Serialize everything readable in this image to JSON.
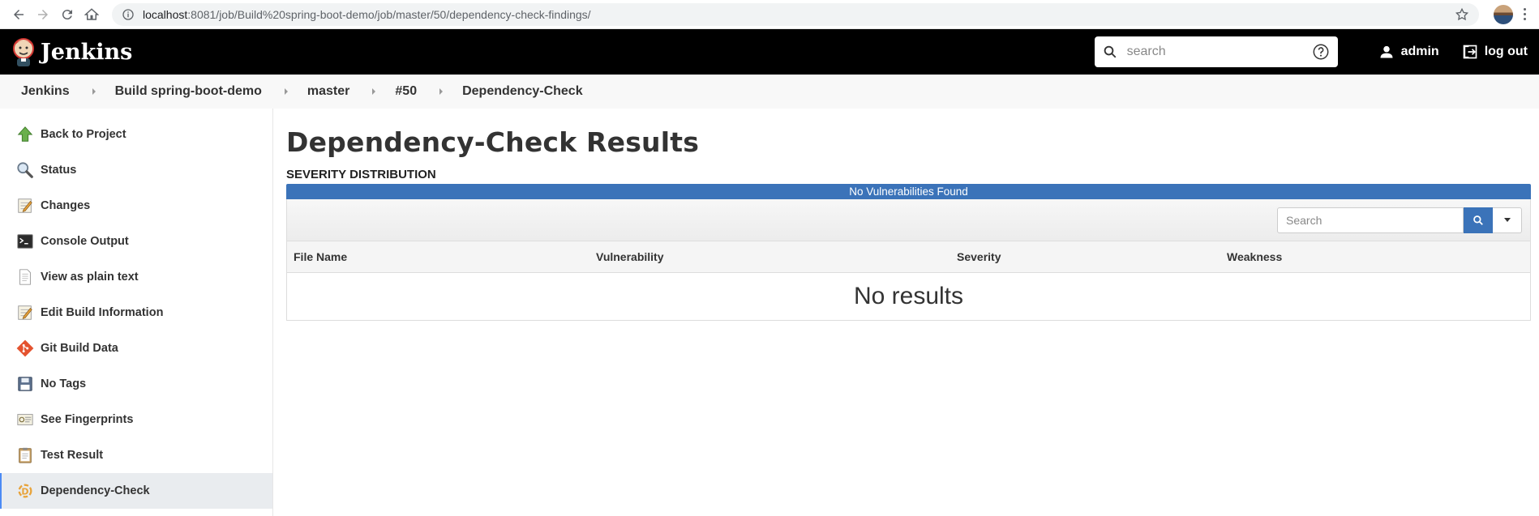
{
  "browser": {
    "url_host": "localhost",
    "url_rest": ":8081/job/Build%20spring-boot-demo/job/master/50/dependency-check-findings/"
  },
  "header": {
    "brand": "Jenkins",
    "search_placeholder": "search",
    "user": "admin",
    "logout": "log out"
  },
  "breadcrumbs": [
    "Jenkins",
    "Build spring-boot-demo",
    "master",
    "#50",
    "Dependency-Check"
  ],
  "sidebar": {
    "items": [
      {
        "label": "Back to Project",
        "icon": "up-arrow-icon"
      },
      {
        "label": "Status",
        "icon": "magnifier-icon"
      },
      {
        "label": "Changes",
        "icon": "notepad-icon"
      },
      {
        "label": "Console Output",
        "icon": "terminal-icon"
      },
      {
        "label": "View as plain text",
        "icon": "document-icon"
      },
      {
        "label": "Edit Build Information",
        "icon": "notepad-edit-icon"
      },
      {
        "label": "Git Build Data",
        "icon": "git-icon"
      },
      {
        "label": "No Tags",
        "icon": "save-icon"
      },
      {
        "label": "See Fingerprints",
        "icon": "fingerprint-card-icon"
      },
      {
        "label": "Test Result",
        "icon": "clipboard-icon"
      },
      {
        "label": "Dependency-Check",
        "icon": "dependency-check-icon"
      }
    ]
  },
  "main": {
    "title": "Dependency-Check Results",
    "section": "SEVERITY DISTRIBUTION",
    "severity_bar": "No Vulnerabilities Found",
    "search_placeholder": "Search",
    "columns": [
      "File Name",
      "Vulnerability",
      "Severity",
      "Weakness"
    ],
    "empty_message": "No results"
  },
  "colors": {
    "header_bg": "#000000",
    "accent_blue": "#3b73b9"
  }
}
